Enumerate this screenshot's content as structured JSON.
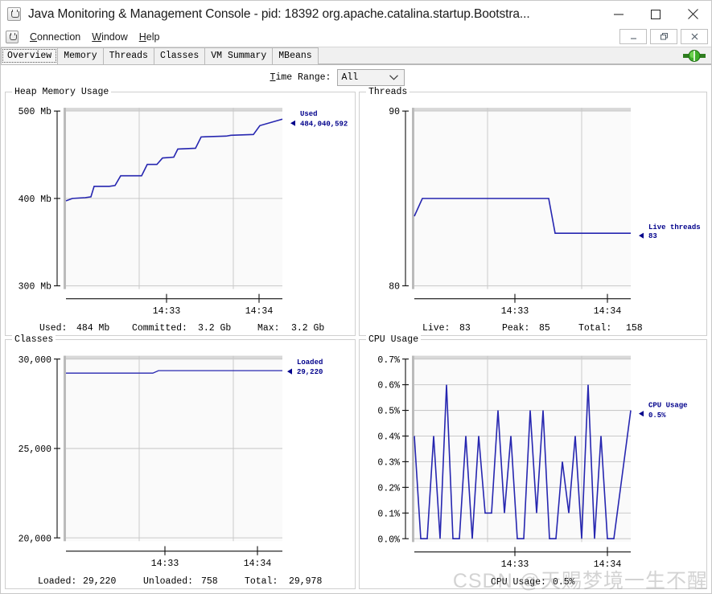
{
  "window": {
    "title": "Java Monitoring & Management Console - pid: 18392 org.apache.catalina.startup.Bootstra...",
    "app_icon": "java-cup-icon",
    "minimize_label": "—",
    "maximize_label": "□",
    "close_label": "✕"
  },
  "menubar": {
    "icon": "java-cup-icon",
    "items": [
      {
        "label": "Connection",
        "mnemonic": "C"
      },
      {
        "label": "Window",
        "mnemonic": "W"
      },
      {
        "label": "Help",
        "mnemonic": "H"
      }
    ],
    "inner_minimize": "_",
    "inner_restore": "❐",
    "inner_close": "✕"
  },
  "tabs": {
    "items": [
      "Overview",
      "Memory",
      "Threads",
      "Classes",
      "VM Summary",
      "MBeans"
    ],
    "active": "Overview",
    "connection_icon": "green-connector-icon"
  },
  "toolbar": {
    "time_range_label": "Time Range:",
    "time_range_mnemonic": "T",
    "time_range_value": "All",
    "time_range_options": [
      "All"
    ]
  },
  "watermark": "CSDN @天赐梦境一生不醒",
  "chart_data": [
    {
      "type": "line",
      "id": "heap-memory-usage",
      "title": "Heap Memory Usage",
      "xlabel": "",
      "ylabel": "",
      "ytick_labels": [
        "500 Mb",
        "400 Mb",
        "300 Mb"
      ],
      "ytick_values": [
        500,
        400,
        300
      ],
      "ylim": [
        300,
        500
      ],
      "xtick_labels": [
        "14:33",
        "14:34"
      ],
      "grid": true,
      "legend_position": "right",
      "series": [
        {
          "name": "Used",
          "value_label": "484,040,592",
          "color": "#2626b0",
          "points": [
            [
              0.0,
              396
            ],
            [
              0.03,
              398
            ],
            [
              0.1,
              399
            ],
            [
              0.125,
              400
            ],
            [
              0.15,
              412
            ],
            [
              0.22,
              412
            ],
            [
              0.28,
              413
            ],
            [
              0.305,
              424
            ],
            [
              0.4,
              424
            ],
            [
              0.425,
              437
            ],
            [
              0.47,
              437
            ],
            [
              0.495,
              444
            ],
            [
              0.545,
              445
            ],
            [
              0.565,
              454
            ],
            [
              0.645,
              455
            ],
            [
              0.665,
              468
            ],
            [
              0.78,
              469
            ],
            [
              0.8,
              470
            ],
            [
              0.905,
              471
            ],
            [
              0.935,
              481
            ],
            [
              1.0,
              488
            ]
          ]
        }
      ],
      "footer": [
        {
          "label": "Used:",
          "value": "484  Mb"
        },
        {
          "label": "Committed:",
          "value": "3.2  Gb"
        },
        {
          "label": "Max:",
          "value": "3.2  Gb"
        }
      ]
    },
    {
      "type": "line",
      "id": "threads",
      "title": "Threads",
      "xlabel": "",
      "ylabel": "",
      "ytick_labels": [
        "90",
        "80"
      ],
      "ytick_values": [
        90,
        80
      ],
      "ylim": [
        80,
        90
      ],
      "xtick_labels": [
        "14:33",
        "14:34"
      ],
      "grid": true,
      "legend_position": "right",
      "series": [
        {
          "name": "Live threads",
          "value_label": "83",
          "color": "#2626b0",
          "points": [
            [
              0.0,
              83.5
            ],
            [
              0.035,
              85.0
            ],
            [
              0.62,
              85.0
            ],
            [
              0.655,
              83.0
            ],
            [
              1.0,
              83.0
            ]
          ]
        }
      ],
      "footer": [
        {
          "label": "Live:",
          "value": "83"
        },
        {
          "label": "Peak:",
          "value": "85"
        },
        {
          "label": "Total:",
          "value": "158"
        }
      ]
    },
    {
      "type": "line",
      "id": "classes",
      "title": "Classes",
      "xlabel": "",
      "ylabel": "",
      "ytick_labels": [
        "30,000",
        "25,000",
        "20,000"
      ],
      "ytick_values": [
        30000,
        25000,
        20000
      ],
      "ylim": [
        20000,
        30000
      ],
      "xtick_labels": [
        "14:33",
        "14:34"
      ],
      "grid": true,
      "legend_position": "right",
      "series": [
        {
          "name": "Loaded",
          "value_label": "29,220",
          "color": "#2626b0",
          "points": [
            [
              0.0,
              29210
            ],
            [
              0.42,
              29212
            ],
            [
              0.44,
              29220
            ],
            [
              1.0,
              29220
            ]
          ]
        }
      ],
      "footer": [
        {
          "label": "Loaded:",
          "value": "29,220"
        },
        {
          "label": "Unloaded:",
          "value": "758"
        },
        {
          "label": "Total:",
          "value": "29,978"
        }
      ]
    },
    {
      "type": "line",
      "id": "cpu-usage",
      "title": "CPU Usage",
      "xlabel": "",
      "ylabel": "",
      "ytick_labels": [
        "0.7%",
        "0.6%",
        "0.5%",
        "0.4%",
        "0.3%",
        "0.2%",
        "0.1%",
        "0.0%"
      ],
      "ytick_values": [
        0.7,
        0.6,
        0.5,
        0.4,
        0.3,
        0.2,
        0.1,
        0.0
      ],
      "ylim": [
        0.0,
        0.7
      ],
      "xtick_labels": [
        "14:33",
        "14:34"
      ],
      "grid": true,
      "legend_position": "right",
      "series": [
        {
          "name": "CPU Usage",
          "value_label": "0.5%",
          "color": "#2626b0",
          "values": [
            0.4,
            0.0,
            0.0,
            0.4,
            0.0,
            0.6,
            0.0,
            0.0,
            0.4,
            0.0,
            0.4,
            0.1,
            0.1,
            0.5,
            0.1,
            0.4,
            0.0,
            0.0,
            0.5,
            0.1,
            0.5,
            0.0,
            0.0,
            0.3,
            0.1,
            0.4,
            0.0,
            0.6,
            0.0,
            0.4,
            0.0,
            0.0,
            0.5
          ]
        }
      ],
      "footer": [
        {
          "label": "CPU Usage:",
          "value": "0.5%"
        }
      ]
    }
  ]
}
